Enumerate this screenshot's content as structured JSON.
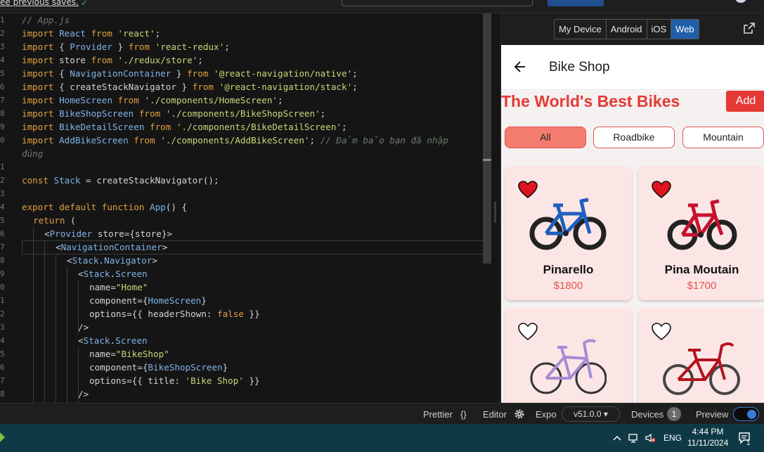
{
  "topbar": {
    "save_message": "ee previous saves.",
    "save_check": "✓"
  },
  "editor": {
    "lines": [
      {
        "n": "1"
      },
      {
        "n": "2"
      },
      {
        "n": "3"
      },
      {
        "n": "4"
      },
      {
        "n": "5"
      },
      {
        "n": "6"
      },
      {
        "n": "7"
      },
      {
        "n": "8"
      },
      {
        "n": "9"
      },
      {
        "n": "0"
      },
      {
        "n": ""
      },
      {
        "n": "1"
      },
      {
        "n": "2"
      },
      {
        "n": "3"
      },
      {
        "n": "4"
      },
      {
        "n": "5"
      },
      {
        "n": "6"
      },
      {
        "n": "7"
      },
      {
        "n": "8"
      },
      {
        "n": "9"
      },
      {
        "n": "0"
      },
      {
        "n": "1"
      },
      {
        "n": "2"
      },
      {
        "n": "3"
      },
      {
        "n": "4"
      },
      {
        "n": "5"
      },
      {
        "n": "6"
      },
      {
        "n": "7"
      },
      {
        "n": "8"
      }
    ],
    "code": {
      "l1": "// App.js",
      "l2a": "import",
      "l2b": "React",
      "l2c": "from",
      "l2d": "'react'",
      "l3a": "import",
      "l3b": "{ ",
      "l3c": "Provider",
      "l3d": " }",
      "l3e": "from",
      "l3f": "'react-redux'",
      "l4a": "import",
      "l4b": "store",
      "l4c": "from",
      "l4d": "'./redux/store'",
      "l5a": "import",
      "l5b": "{ ",
      "l5c": "NavigationContainer",
      "l5d": " }",
      "l5e": "from",
      "l5f": "'@react-navigation/native'",
      "l6a": "import",
      "l6b": "{ createStackNavigator }",
      "l6c": "from",
      "l6d": "'@react-navigation/stack'",
      "l7a": "import",
      "l7b": "HomeScreen",
      "l7c": "from",
      "l7d": "'./components/HomeScreen'",
      "l8a": "import",
      "l8b": "BikeShopScreen",
      "l8c": "from",
      "l8d": "'./components/BikeShopScreen'",
      "l9a": "import",
      "l9b": "BikeDetailScreen",
      "l9c": "from",
      "l9d": "'./components/BikeDetailScreen'",
      "l10a": "import",
      "l10b": "AddBikeScreen",
      "l10c": "from",
      "l10d": "'./components/AddBikeScreen'",
      "l10e": "// Đảm bảo bạn đã nhập",
      "l11": "đúng",
      "l13a": "const",
      "l13b": "Stack",
      "l13c": "= createStackNavigator();",
      "l15a": "export default function",
      "l15b": "App",
      "l15c": "() {",
      "l16a": "return",
      "l16b": " (",
      "l17a": "<",
      "l17b": "Provider",
      "l17c": " store={store}>",
      "l18a": "<",
      "l18b": "NavigationContainer",
      "l18c": ">",
      "l19a": "<",
      "l19b": "Stack",
      "l19c": ".",
      "l19d": "Navigator",
      "l19e": ">",
      "l20a": "<",
      "l20b": "Stack",
      "l20c": ".",
      "l20d": "Screen",
      "l21a": "name=",
      "l21b": "\"Home\"",
      "l22a": "component={",
      "l22b": "HomeScreen",
      "l22c": "}",
      "l23a": "options={{ headerShown: ",
      "l23b": "false",
      "l23c": " }}",
      "l24": "/>",
      "l25a": "<",
      "l25b": "Stack",
      "l25c": ".",
      "l25d": "Screen",
      "l26a": "name=",
      "l26b": "\"BikeShop\"",
      "l27a": "component={",
      "l27b": "BikeShopScreen",
      "l27c": "}",
      "l28a": "options={{ title: ",
      "l28b": "'Bike Shop'",
      "l28c": " }}",
      "l29": "/>"
    }
  },
  "preview": {
    "device_tabs": [
      "My Device",
      "Android",
      "iOS",
      "Web"
    ],
    "active_tab": "Web",
    "app": {
      "header_title": "Bike Shop",
      "hero_title": "The World's Best Bikes",
      "add_label": "Add",
      "filters": [
        "All",
        "Roadbike",
        "Mountain"
      ],
      "active_filter": "All",
      "products": [
        {
          "name": "Pinarello",
          "price": "$1800",
          "liked": true,
          "color": "#1f5fbf"
        },
        {
          "name": "Pina Moutain",
          "price": "$1700",
          "liked": true,
          "color": "#c8102e"
        },
        {
          "name": "",
          "price": "",
          "liked": false,
          "color": "#a58bd6"
        },
        {
          "name": "",
          "price": "",
          "liked": false,
          "color": "#b3121f"
        }
      ]
    }
  },
  "statusbar": {
    "prettier": "Prettier",
    "prettier_icon": "{}",
    "editor": "Editor",
    "expo": "Expo",
    "expo_version": "v51.0.0 ▾",
    "devices": "Devices",
    "devices_count": "1",
    "preview": "Preview"
  },
  "taskbar": {
    "lang": "ENG",
    "time": "4:44 PM",
    "date": "11/11/2024",
    "notification_count": "1"
  }
}
